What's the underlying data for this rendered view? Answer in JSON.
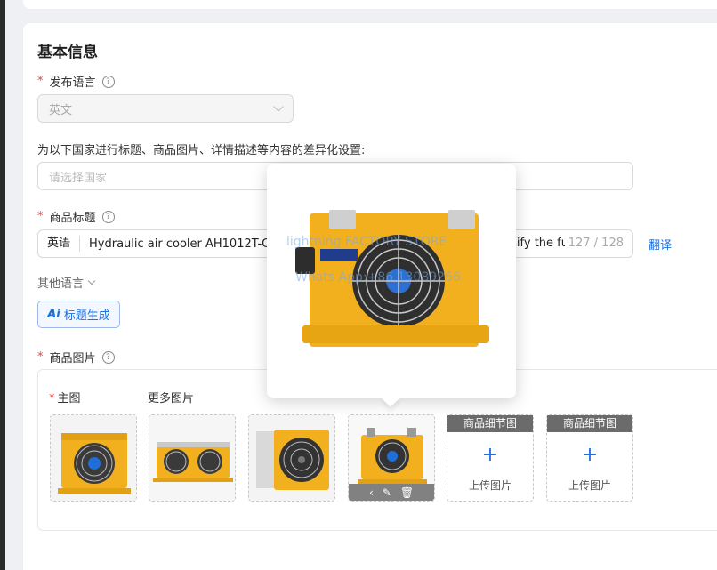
{
  "section_title": "基本信息",
  "publish_language": {
    "label": "发布语言",
    "value": "英文"
  },
  "country_diff": {
    "label": "为以下国家进行标题、商品图片、详情描述等内容的差异化设置:",
    "placeholder": "请选择国家"
  },
  "product_title": {
    "label": "商品标题",
    "lang_prefix": "英语",
    "text": "Hydraulic air cooler AH1012T-CA",
    "tail": "ify the fu",
    "counter": "127 / 128",
    "translate": "翻译"
  },
  "other_languages": "其他语言",
  "ai_button": {
    "mark": "Ai",
    "label": "标题生成"
  },
  "product_images": {
    "label": "商品图片",
    "main_label": "主图",
    "more_label": "更多图片",
    "upload_slots": [
      {
        "header": "商品细节图",
        "text": "上传图片"
      },
      {
        "header": "商品细节图",
        "text": "上传图片"
      }
    ]
  },
  "preview_watermark": {
    "line1": "lightning FACTORY STORE",
    "line2": "Whats App:+86 13089266"
  },
  "colors": {
    "accent": "#1e6fd9",
    "required": "#e54545",
    "product_yellow": "#f2b01e"
  }
}
